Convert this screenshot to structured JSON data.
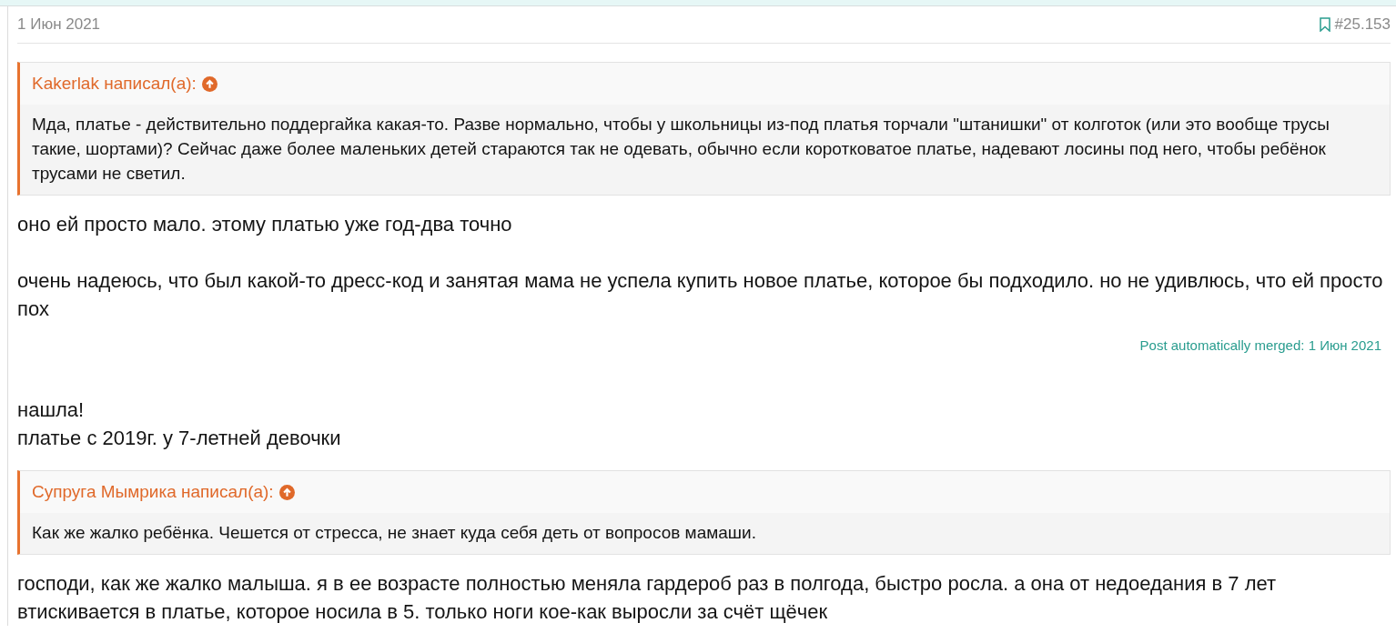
{
  "post": {
    "date": "1 Июн 2021",
    "number": "#25.153"
  },
  "blocks": [
    {
      "kind": "quote",
      "author": "Kakerlak написал(а):",
      "text": "Мда, платье - действительно поддергайка какая-то. Разве нормально, чтобы у школьницы из-под платья торчали \"штанишки\" от колготок (или это вообще трусы такие, шортами)? Сейчас даже более маленьких детей стараются так не одевать, обычно если коротковатое платье, надевают лосины под него, чтобы ребёнок трусами не светил."
    },
    {
      "kind": "text",
      "text": "оно ей просто мало. этому платью уже год-два точно"
    },
    {
      "kind": "gap"
    },
    {
      "kind": "text",
      "text": "очень надеюсь, что был какой-то дресс-код и занятая мама не успела купить новое платье, которое бы подходило. но не удивлюсь, что ей просто пох"
    },
    {
      "kind": "merge",
      "text": "Post automatically merged: 1 Июн 2021"
    },
    {
      "kind": "text",
      "text": "нашла!"
    },
    {
      "kind": "text",
      "text": "платье с 2019г. у 7-летней девочки"
    },
    {
      "kind": "quote",
      "author": "Супруга Мымрика написал(а):",
      "text": "Как же жалко ребёнка. Чешется от стресса, не знает куда себя деть от вопросов мамаши."
    },
    {
      "kind": "text",
      "text": "господи, как же жалко малыша. я в ее возрасте полностью меняла гардероб раз в полгода, быстро росла. а она от недоедания в 7 лет втискивается в платье, которое носила в 5. только ноги кое-как выросли за счёт щёчек"
    }
  ]
}
